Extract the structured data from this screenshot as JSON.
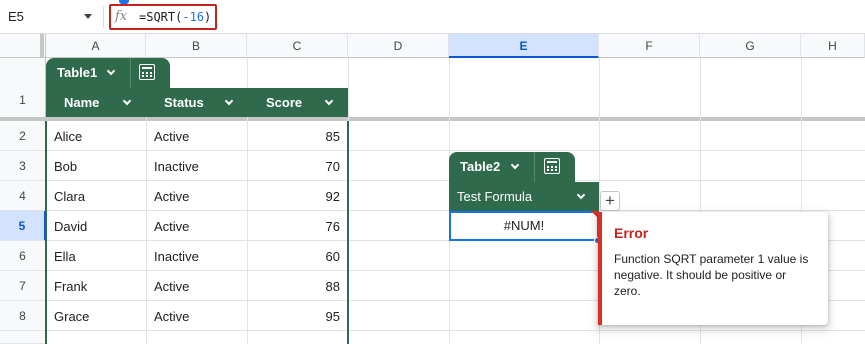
{
  "formula_bar": {
    "name_box": "E5",
    "fx_label": "fx",
    "formula_prefix": "=SQRT(",
    "formula_number": "-16",
    "formula_suffix": ")"
  },
  "columns": [
    "A",
    "B",
    "C",
    "D",
    "E",
    "F",
    "G",
    "H"
  ],
  "selected_column": "E",
  "rows": [
    "1",
    "2",
    "3",
    "4",
    "5",
    "6",
    "7",
    "8"
  ],
  "selected_row": "5",
  "table1": {
    "name": "Table1",
    "headers": [
      "Name",
      "Status",
      "Score"
    ],
    "rows": [
      [
        "Alice",
        "Active",
        "85"
      ],
      [
        "Bob",
        "Inactive",
        "70"
      ],
      [
        "Clara",
        "Active",
        "92"
      ],
      [
        "David",
        "Active",
        "76"
      ],
      [
        "Ella",
        "Inactive",
        "60"
      ],
      [
        "Frank",
        "Active",
        "88"
      ],
      [
        "Grace",
        "Active",
        "95"
      ]
    ]
  },
  "table2": {
    "name": "Table2",
    "header": "Test Formula",
    "value": "#NUM!"
  },
  "error_popup": {
    "title": "Error",
    "message": "Function SQRT parameter 1 value is negative. It should be positive or zero."
  },
  "colors": {
    "table_green": "#2f6a4d",
    "selection_blue": "#0b57d0",
    "error_red": "#d93025"
  }
}
